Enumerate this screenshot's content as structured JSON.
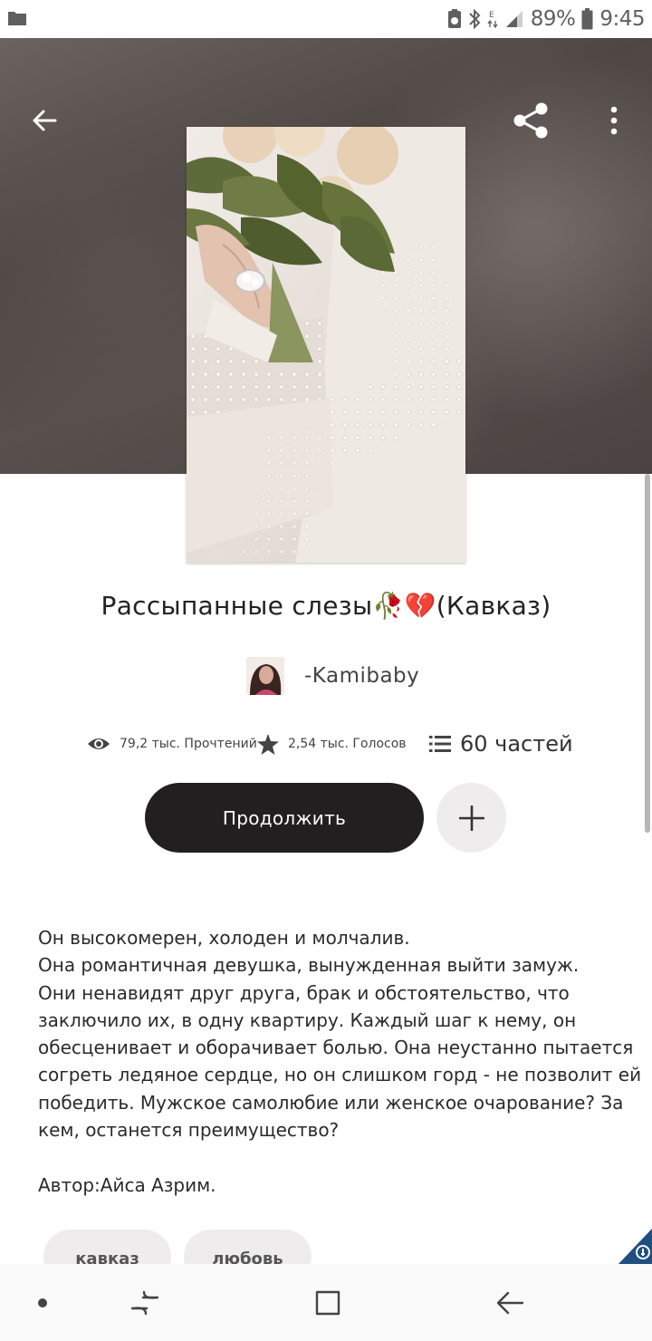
{
  "status_bar": {
    "battery": "89%",
    "time": "9:45",
    "icons": [
      "folder-icon",
      "data-saver-icon",
      "bluetooth-icon",
      "network-e-icon",
      "signal-icon",
      "battery-icon"
    ]
  },
  "toolbar": {
    "icons": [
      "arrow-left-icon",
      "share-icon",
      "more-vertical-icon"
    ]
  },
  "story": {
    "title": "Рассыпанные слезы🥀💔(Кавказ)",
    "author": "-Kamibaby",
    "reads": "79,2 тыс. Прочтений",
    "votes": "2,54 тыс. Голосов",
    "parts": "60 частей",
    "continue_label": "Продолжить",
    "description_lines": [
      "Он высокомерен, холоден и молчалив.",
      "Она романтичная девушка, вынужденная выйти замуж.",
      "Они ненавидят друг друга, брак и обстоятельство, что",
      "заключило их, в одну квартиру. Каждый шаг к нему, он",
      "обесценивает и оборачивает болью. Она неустанно пытается",
      "согреть ледяное сердце, но он слишком горд - не позволит ей",
      "победить. Мужское самолюбие или женское очарование? За",
      "кем, останется преимущество?"
    ],
    "author_note": "Автор:Айса Азрим.",
    "tags": [
      "кавказ",
      "любовь"
    ]
  },
  "colors": {
    "accent_dark": "#221f20",
    "chip_bg": "#efeced",
    "badge": "#1f4f7f"
  },
  "nav_bar": {
    "icons": [
      "dot-icon",
      "recents-icon",
      "home-icon",
      "back-icon"
    ]
  }
}
